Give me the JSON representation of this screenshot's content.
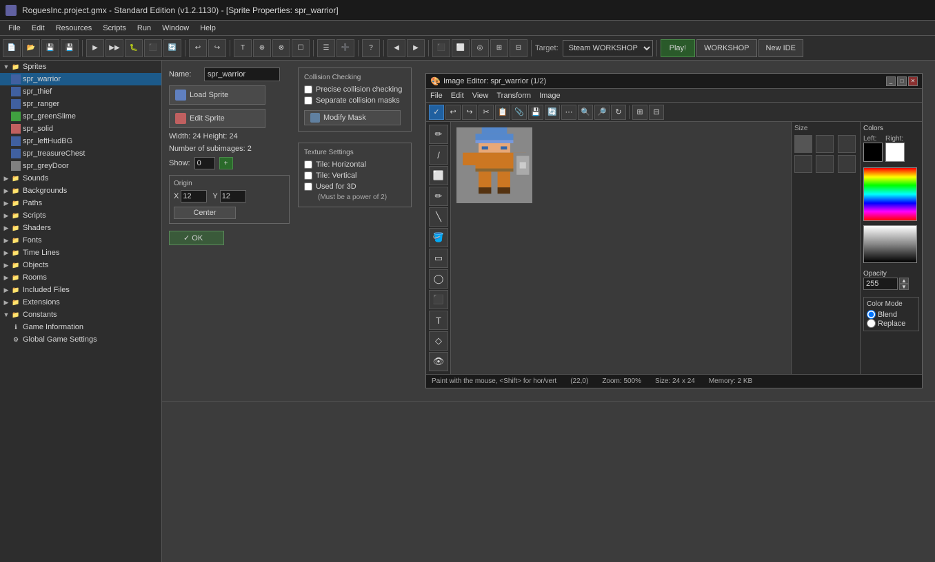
{
  "title_bar": {
    "title": "RoguesInc.project.gmx  -  Standard Edition (v1.2.1130) - [Sprite Properties: spr_warrior]",
    "app_name": "RoguesInc"
  },
  "menu_bar": {
    "items": [
      "File",
      "Edit",
      "Resources",
      "Scripts",
      "Run",
      "Window",
      "Help"
    ]
  },
  "toolbar": {
    "target_label": "Target:",
    "target_value": "Steam WORKSHOP",
    "play_label": "Play!",
    "workshop_label": "WORKSHOP",
    "new_ide_label": "New IDE"
  },
  "sidebar": {
    "tree": [
      {
        "id": "sprites",
        "label": "Sprites",
        "type": "folder",
        "expanded": true,
        "depth": 0
      },
      {
        "id": "spr_warrior",
        "label": "spr_warrior",
        "type": "sprite",
        "depth": 1,
        "selected": true
      },
      {
        "id": "spr_thief",
        "label": "spr_thief",
        "type": "sprite",
        "depth": 1
      },
      {
        "id": "spr_ranger",
        "label": "spr_ranger",
        "type": "sprite",
        "depth": 1
      },
      {
        "id": "spr_greenSlime",
        "label": "spr_greenSlime",
        "type": "sprite",
        "depth": 1
      },
      {
        "id": "spr_solid",
        "label": "spr_solid",
        "type": "sprite",
        "depth": 1
      },
      {
        "id": "spr_leftHudBG",
        "label": "spr_leftHudBG",
        "type": "sprite",
        "depth": 1
      },
      {
        "id": "spr_treasureChest",
        "label": "spr_treasureChest",
        "type": "sprite",
        "depth": 1
      },
      {
        "id": "spr_greyDoor",
        "label": "spr_greyDoor",
        "type": "sprite",
        "depth": 1
      },
      {
        "id": "sounds",
        "label": "Sounds",
        "type": "folder",
        "depth": 0
      },
      {
        "id": "backgrounds",
        "label": "Backgrounds",
        "type": "folder",
        "depth": 0
      },
      {
        "id": "paths",
        "label": "Paths",
        "type": "folder",
        "depth": 0
      },
      {
        "id": "scripts",
        "label": "Scripts",
        "type": "folder",
        "depth": 0
      },
      {
        "id": "shaders",
        "label": "Shaders",
        "type": "folder",
        "depth": 0
      },
      {
        "id": "fonts",
        "label": "Fonts",
        "type": "folder",
        "depth": 0
      },
      {
        "id": "time_lines",
        "label": "Time Lines",
        "type": "folder",
        "depth": 0
      },
      {
        "id": "objects",
        "label": "Objects",
        "type": "folder",
        "depth": 0
      },
      {
        "id": "rooms",
        "label": "Rooms",
        "type": "folder",
        "depth": 0
      },
      {
        "id": "included_files",
        "label": "Included Files",
        "type": "folder",
        "depth": 0
      },
      {
        "id": "extensions",
        "label": "Extensions",
        "type": "folder",
        "depth": 0
      },
      {
        "id": "constants",
        "label": "Constants",
        "type": "folder",
        "depth": 0,
        "expanded": true
      },
      {
        "id": "game_information",
        "label": "Game Information",
        "type": "info",
        "depth": 1
      },
      {
        "id": "global_game_settings",
        "label": "Global Game Settings",
        "type": "settings",
        "depth": 1
      }
    ]
  },
  "sprite_props": {
    "name_label": "Name:",
    "name_value": "spr_warrior",
    "load_sprite_label": "Load Sprite",
    "edit_sprite_label": "Edit Sprite",
    "width_label": "Width:",
    "width_value": "24",
    "height_label": "Height:",
    "height_value": "24",
    "subimages_label": "Number of subimages:",
    "subimages_value": "2",
    "show_label": "Show:",
    "show_value": "0",
    "origin_label": "Origin",
    "origin_x_label": "X",
    "origin_x_value": "12",
    "origin_y_label": "Y",
    "origin_y_value": "12",
    "center_label": "Center",
    "ok_label": "✓ OK"
  },
  "collision": {
    "group_label": "Collision Checking",
    "precise_label": "Precise collision checking",
    "precise_checked": false,
    "separate_label": "Separate collision masks",
    "separate_checked": false,
    "modify_mask_label": "Modify Mask"
  },
  "texture": {
    "group_label": "Texture Settings",
    "tile_h_label": "Tile: Horizontal",
    "tile_h_checked": false,
    "tile_v_label": "Tile: Vertical",
    "tile_v_checked": false,
    "used_3d_label": "Used for 3D",
    "used_3d_note": "(Must be a power of 2)",
    "used_3d_checked": false
  },
  "image_editor": {
    "title": "Image Editor: spr_warrior (1/2)",
    "menu_items": [
      "File",
      "Edit",
      "View",
      "Transform",
      "Image"
    ],
    "tools": [
      "pencil",
      "line",
      "eraser",
      "fill",
      "eyedropper",
      "rectangle",
      "circle",
      "zoom",
      "text",
      "diamond",
      "selection"
    ],
    "colors": {
      "title": "Colors",
      "left_label": "Left:",
      "right_label": "Right:",
      "left_color": "#000000",
      "right_color": "#ffffff"
    },
    "opacity": {
      "label": "Opacity",
      "value": "255"
    },
    "color_mode": {
      "label": "Color Mode",
      "blend_label": "Blend",
      "replace_label": "Replace",
      "selected": "Blend"
    },
    "size_label": "Size",
    "status": {
      "hint": "Paint with the mouse, <Shift> for hor/vert",
      "coords": "(22,0)",
      "zoom": "Zoom: 500%",
      "size": "Size: 24 x 24",
      "memory": "Memory: 2 KB"
    }
  }
}
